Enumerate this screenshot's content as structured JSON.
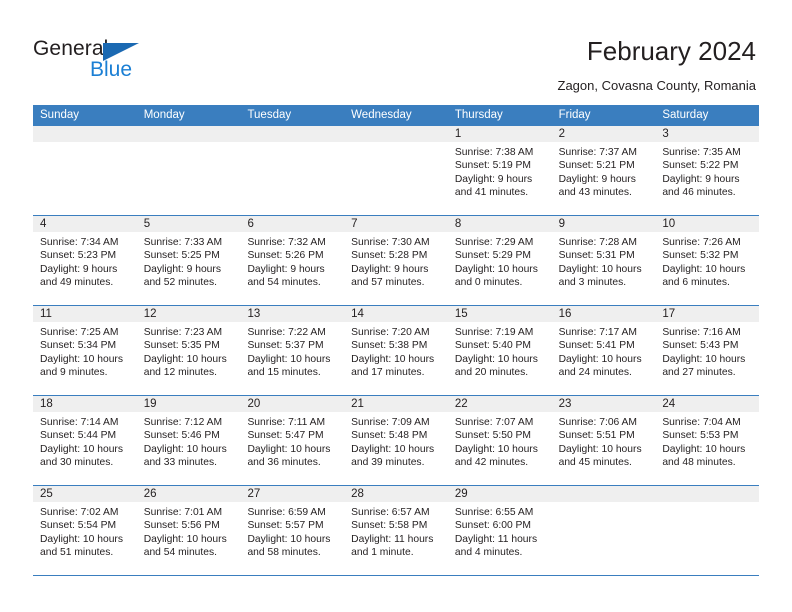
{
  "brand": {
    "name_part1": "General",
    "name_part2": "Blue",
    "triangle_color": "#1b69b2",
    "blue_color": "#1b7fd4"
  },
  "header": {
    "title": "February 2024",
    "subtitle": "Zagon, Covasna County, Romania"
  },
  "theme": {
    "header_blue": "#3a7ebf",
    "day_strip_gray": "#efefef",
    "text": "#231f20"
  },
  "weekdays": [
    "Sunday",
    "Monday",
    "Tuesday",
    "Wednesday",
    "Thursday",
    "Friday",
    "Saturday"
  ],
  "weeks": [
    [
      {
        "day": "",
        "lines": []
      },
      {
        "day": "",
        "lines": []
      },
      {
        "day": "",
        "lines": []
      },
      {
        "day": "",
        "lines": []
      },
      {
        "day": "1",
        "lines": [
          "Sunrise: 7:38 AM",
          "Sunset: 5:19 PM",
          "Daylight: 9 hours",
          "and 41 minutes."
        ]
      },
      {
        "day": "2",
        "lines": [
          "Sunrise: 7:37 AM",
          "Sunset: 5:21 PM",
          "Daylight: 9 hours",
          "and 43 minutes."
        ]
      },
      {
        "day": "3",
        "lines": [
          "Sunrise: 7:35 AM",
          "Sunset: 5:22 PM",
          "Daylight: 9 hours",
          "and 46 minutes."
        ]
      }
    ],
    [
      {
        "day": "4",
        "lines": [
          "Sunrise: 7:34 AM",
          "Sunset: 5:23 PM",
          "Daylight: 9 hours",
          "and 49 minutes."
        ]
      },
      {
        "day": "5",
        "lines": [
          "Sunrise: 7:33 AM",
          "Sunset: 5:25 PM",
          "Daylight: 9 hours",
          "and 52 minutes."
        ]
      },
      {
        "day": "6",
        "lines": [
          "Sunrise: 7:32 AM",
          "Sunset: 5:26 PM",
          "Daylight: 9 hours",
          "and 54 minutes."
        ]
      },
      {
        "day": "7",
        "lines": [
          "Sunrise: 7:30 AM",
          "Sunset: 5:28 PM",
          "Daylight: 9 hours",
          "and 57 minutes."
        ]
      },
      {
        "day": "8",
        "lines": [
          "Sunrise: 7:29 AM",
          "Sunset: 5:29 PM",
          "Daylight: 10 hours",
          "and 0 minutes."
        ]
      },
      {
        "day": "9",
        "lines": [
          "Sunrise: 7:28 AM",
          "Sunset: 5:31 PM",
          "Daylight: 10 hours",
          "and 3 minutes."
        ]
      },
      {
        "day": "10",
        "lines": [
          "Sunrise: 7:26 AM",
          "Sunset: 5:32 PM",
          "Daylight: 10 hours",
          "and 6 minutes."
        ]
      }
    ],
    [
      {
        "day": "11",
        "lines": [
          "Sunrise: 7:25 AM",
          "Sunset: 5:34 PM",
          "Daylight: 10 hours",
          "and 9 minutes."
        ]
      },
      {
        "day": "12",
        "lines": [
          "Sunrise: 7:23 AM",
          "Sunset: 5:35 PM",
          "Daylight: 10 hours",
          "and 12 minutes."
        ]
      },
      {
        "day": "13",
        "lines": [
          "Sunrise: 7:22 AM",
          "Sunset: 5:37 PM",
          "Daylight: 10 hours",
          "and 15 minutes."
        ]
      },
      {
        "day": "14",
        "lines": [
          "Sunrise: 7:20 AM",
          "Sunset: 5:38 PM",
          "Daylight: 10 hours",
          "and 17 minutes."
        ]
      },
      {
        "day": "15",
        "lines": [
          "Sunrise: 7:19 AM",
          "Sunset: 5:40 PM",
          "Daylight: 10 hours",
          "and 20 minutes."
        ]
      },
      {
        "day": "16",
        "lines": [
          "Sunrise: 7:17 AM",
          "Sunset: 5:41 PM",
          "Daylight: 10 hours",
          "and 24 minutes."
        ]
      },
      {
        "day": "17",
        "lines": [
          "Sunrise: 7:16 AM",
          "Sunset: 5:43 PM",
          "Daylight: 10 hours",
          "and 27 minutes."
        ]
      }
    ],
    [
      {
        "day": "18",
        "lines": [
          "Sunrise: 7:14 AM",
          "Sunset: 5:44 PM",
          "Daylight: 10 hours",
          "and 30 minutes."
        ]
      },
      {
        "day": "19",
        "lines": [
          "Sunrise: 7:12 AM",
          "Sunset: 5:46 PM",
          "Daylight: 10 hours",
          "and 33 minutes."
        ]
      },
      {
        "day": "20",
        "lines": [
          "Sunrise: 7:11 AM",
          "Sunset: 5:47 PM",
          "Daylight: 10 hours",
          "and 36 minutes."
        ]
      },
      {
        "day": "21",
        "lines": [
          "Sunrise: 7:09 AM",
          "Sunset: 5:48 PM",
          "Daylight: 10 hours",
          "and 39 minutes."
        ]
      },
      {
        "day": "22",
        "lines": [
          "Sunrise: 7:07 AM",
          "Sunset: 5:50 PM",
          "Daylight: 10 hours",
          "and 42 minutes."
        ]
      },
      {
        "day": "23",
        "lines": [
          "Sunrise: 7:06 AM",
          "Sunset: 5:51 PM",
          "Daylight: 10 hours",
          "and 45 minutes."
        ]
      },
      {
        "day": "24",
        "lines": [
          "Sunrise: 7:04 AM",
          "Sunset: 5:53 PM",
          "Daylight: 10 hours",
          "and 48 minutes."
        ]
      }
    ],
    [
      {
        "day": "25",
        "lines": [
          "Sunrise: 7:02 AM",
          "Sunset: 5:54 PM",
          "Daylight: 10 hours",
          "and 51 minutes."
        ]
      },
      {
        "day": "26",
        "lines": [
          "Sunrise: 7:01 AM",
          "Sunset: 5:56 PM",
          "Daylight: 10 hours",
          "and 54 minutes."
        ]
      },
      {
        "day": "27",
        "lines": [
          "Sunrise: 6:59 AM",
          "Sunset: 5:57 PM",
          "Daylight: 10 hours",
          "and 58 minutes."
        ]
      },
      {
        "day": "28",
        "lines": [
          "Sunrise: 6:57 AM",
          "Sunset: 5:58 PM",
          "Daylight: 11 hours",
          "and 1 minute."
        ]
      },
      {
        "day": "29",
        "lines": [
          "Sunrise: 6:55 AM",
          "Sunset: 6:00 PM",
          "Daylight: 11 hours",
          "and 4 minutes."
        ]
      },
      {
        "day": "",
        "lines": []
      },
      {
        "day": "",
        "lines": []
      }
    ]
  ]
}
